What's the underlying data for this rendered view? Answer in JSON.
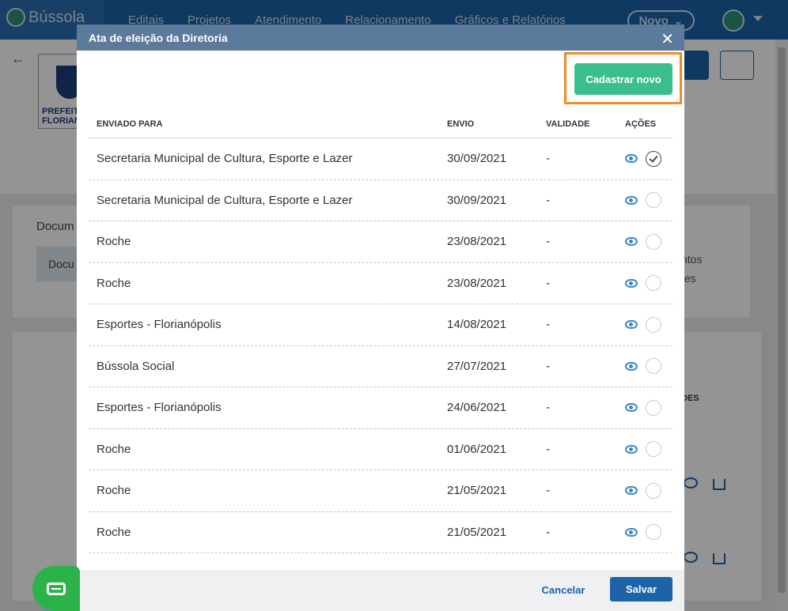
{
  "app": {
    "logo_text": "Bússola",
    "nav": [
      "Editais",
      "Projetos",
      "Atendimento",
      "Relacionamento",
      "Gráficos e Relatórios"
    ],
    "novo_label": "Novo"
  },
  "background": {
    "logo_text": "PREFEIT\nFLORIAN",
    "card_title": "Docum",
    "card_tab": "Docu",
    "side_text_1": "ntos",
    "side_text_2": "tes",
    "table_header_partial": "DES"
  },
  "modal": {
    "title": "Ata de eleição da Diretoria",
    "close_label": "✕",
    "new_button": "Cadastrar novo",
    "columns": [
      "ENVIADO PARA",
      "ENVIO",
      "VALIDADE",
      "AÇÕES"
    ],
    "rows": [
      {
        "enviado_para": "Secretaria Municipal de Cultura, Esporte e Lazer",
        "envio": "30/09/2021",
        "validade": "-",
        "selected": true
      },
      {
        "enviado_para": "Secretaria Municipal de Cultura, Esporte e Lazer",
        "envio": "30/09/2021",
        "validade": "-",
        "selected": false
      },
      {
        "enviado_para": "Roche",
        "envio": "23/08/2021",
        "validade": "-",
        "selected": false
      },
      {
        "enviado_para": "Roche",
        "envio": "23/08/2021",
        "validade": "-",
        "selected": false
      },
      {
        "enviado_para": "Esportes - Florianópolis",
        "envio": "14/08/2021",
        "validade": "-",
        "selected": false
      },
      {
        "enviado_para": "Bússola Social",
        "envio": "27/07/2021",
        "validade": "-",
        "selected": false
      },
      {
        "enviado_para": "Esportes - Florianópolis",
        "envio": "24/06/2021",
        "validade": "-",
        "selected": false
      },
      {
        "enviado_para": "Roche",
        "envio": "01/06/2021",
        "validade": "-",
        "selected": false
      },
      {
        "enviado_para": "Roche",
        "envio": "21/05/2021",
        "validade": "-",
        "selected": false
      },
      {
        "enviado_para": "Roche",
        "envio": "21/05/2021",
        "validade": "-",
        "selected": false
      }
    ],
    "cancel_label": "Cancelar",
    "save_label": "Salvar"
  },
  "colors": {
    "primary": "#1d63a8",
    "accent_green": "#3cbf8f",
    "highlight_orange": "#f28c28",
    "modal_header": "#5c7a9b"
  }
}
